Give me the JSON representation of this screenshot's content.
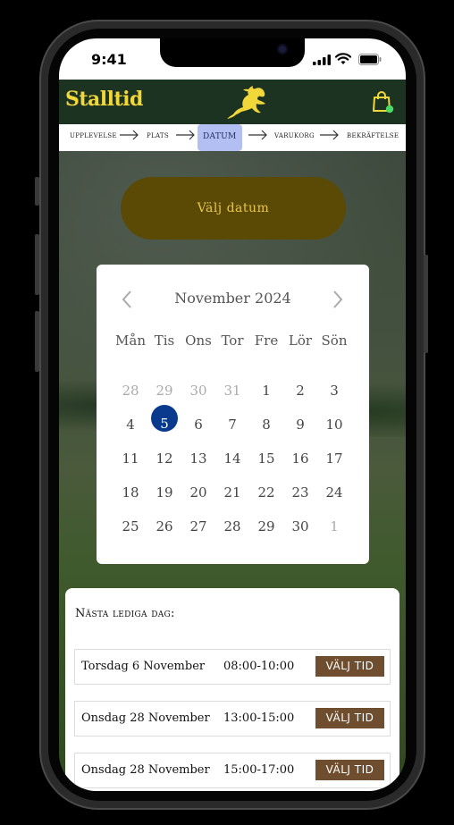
{
  "status_bar": {
    "time": "9:41"
  },
  "header": {
    "brand": "Stalltid",
    "colors": {
      "bar": "#1b3320",
      "brand_text": "#f2d73b",
      "cart_badge": "#4cd964"
    }
  },
  "steps": {
    "items": [
      {
        "label": "Upplevelse",
        "active": false
      },
      {
        "label": "Plats",
        "active": false
      },
      {
        "label": "Datum",
        "active": true
      },
      {
        "label": "Varukorg",
        "active": false
      },
      {
        "label": "Bekräftelse",
        "active": false
      }
    ]
  },
  "pick_date_button": {
    "label": "Välj datum"
  },
  "calendar": {
    "month_title": "November 2024",
    "weekdays": [
      "Mån",
      "Tis",
      "Ons",
      "Tor",
      "Fre",
      "Lör",
      "Sön"
    ],
    "weeks": [
      [
        "28",
        "29",
        "30",
        "31",
        "1",
        "2",
        "3"
      ],
      [
        "4",
        "5",
        "6",
        "7",
        "8",
        "9",
        "10"
      ],
      [
        "11",
        "12",
        "13",
        "14",
        "15",
        "16",
        "17"
      ],
      [
        "18",
        "19",
        "20",
        "21",
        "22",
        "23",
        "24"
      ],
      [
        "25",
        "26",
        "27",
        "28",
        "29",
        "30",
        "1"
      ]
    ],
    "selected_day": "5",
    "selected_color": "#0a3a8e"
  },
  "next_available": {
    "title": "Nästa lediga dag:",
    "slots": [
      {
        "date": "Torsdag 6 November",
        "time": "08:00-10:00",
        "button": "VÄLJ TID"
      },
      {
        "date": "Onsdag 28 November",
        "time": "13:00-15:00",
        "button": "VÄLJ TID"
      },
      {
        "date": "Onsdag 28 November",
        "time": "15:00-17:00",
        "button": "VÄLJ TID"
      }
    ],
    "button_color": "#6f4e2f"
  }
}
